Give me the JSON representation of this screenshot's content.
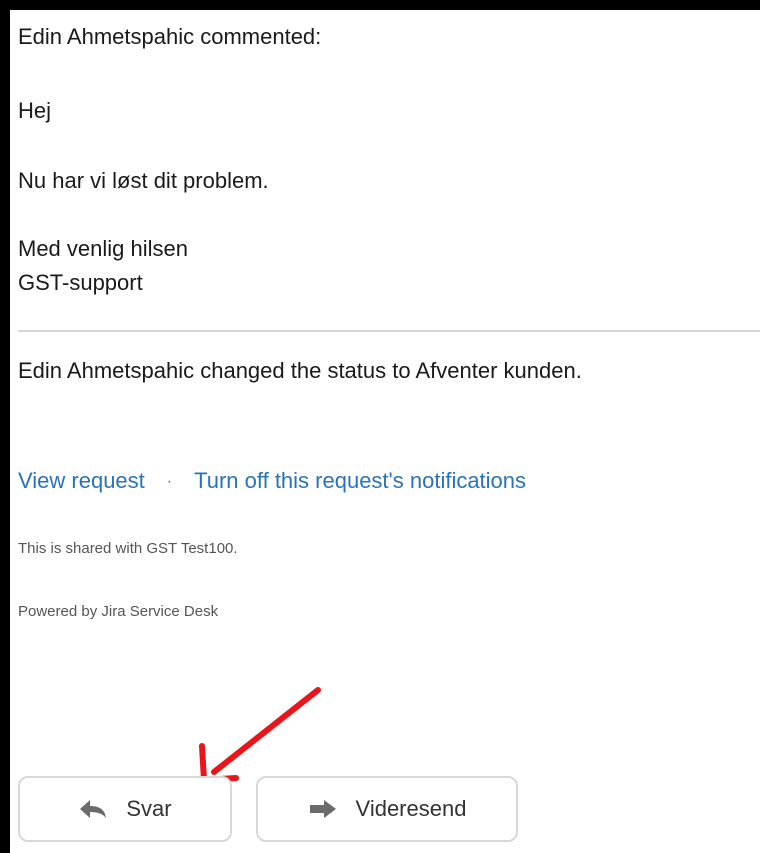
{
  "email": {
    "comment_header": "Edin Ahmetspahic commented:",
    "greeting": "Hej",
    "body": "Nu har vi løst dit problem.",
    "signoff_line1": "Med venlig hilsen",
    "signoff_line2": "GST-support",
    "status_change": "Edin Ahmetspahic changed the status to Afventer kunden.",
    "links": {
      "view_request": "View request",
      "separator": "·",
      "turn_off_notifications": "Turn off this request's notifications"
    },
    "shared_with": "This is shared with GST Test100.",
    "powered_by": "Powered by Jira Service Desk"
  },
  "actions": {
    "reply_label": "Svar",
    "forward_label": "Videresend"
  },
  "icons": {
    "reply": "reply-arrow-icon",
    "forward": "forward-arrow-icon",
    "annotation": "red-pointer-arrow"
  },
  "colors": {
    "link": "#2a73b8",
    "annotation": "#e8151b"
  }
}
